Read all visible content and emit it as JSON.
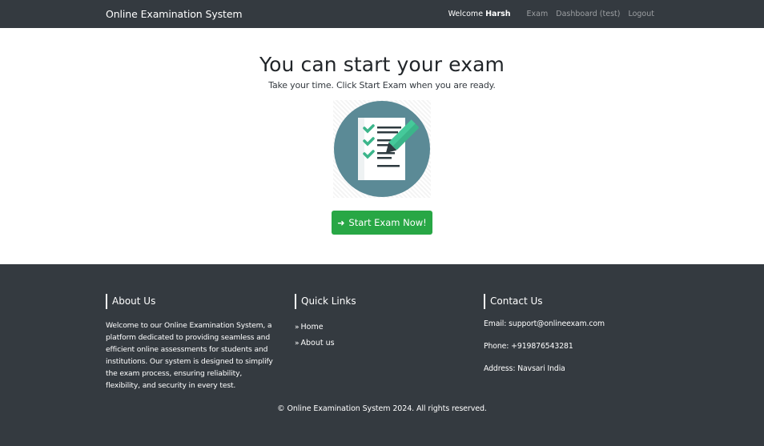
{
  "navbar": {
    "brand": "Online Examination System",
    "welcome_prefix": "Welcome",
    "username": "Harsh",
    "links": [
      "Exam",
      "Dashboard (test)",
      "Logout"
    ]
  },
  "main": {
    "title": "You can start your exam",
    "subtitle": "Take your time. Click Start Exam when you are ready.",
    "start_button": "Start Exam Now!"
  },
  "footer": {
    "about": {
      "heading": "About Us",
      "text": "Welcome to our Online Examination System, a platform dedicated to providing seamless and efficient online assessments for students and institutions. Our system is designed to simplify the exam process, ensuring reliability, flexibility, and security in every test."
    },
    "quick_links": {
      "heading": "Quick Links",
      "items": [
        "Home",
        "About us"
      ]
    },
    "contact": {
      "heading": "Contact Us",
      "email": "Email: support@onlineexam.com",
      "phone": "Phone: +919876543281",
      "address": "Address: Navsari India"
    },
    "copyright": "© Online Examination System 2024. All rights reserved."
  },
  "colors": {
    "navbar": "#343a40",
    "accent_green": "#28a745",
    "illustration_circle": "#5b8a96"
  },
  "icons": {
    "illustration": "checklist-clipboard-icon",
    "button": "arrow-right-icon",
    "links": "double-chevron-right-icon"
  }
}
